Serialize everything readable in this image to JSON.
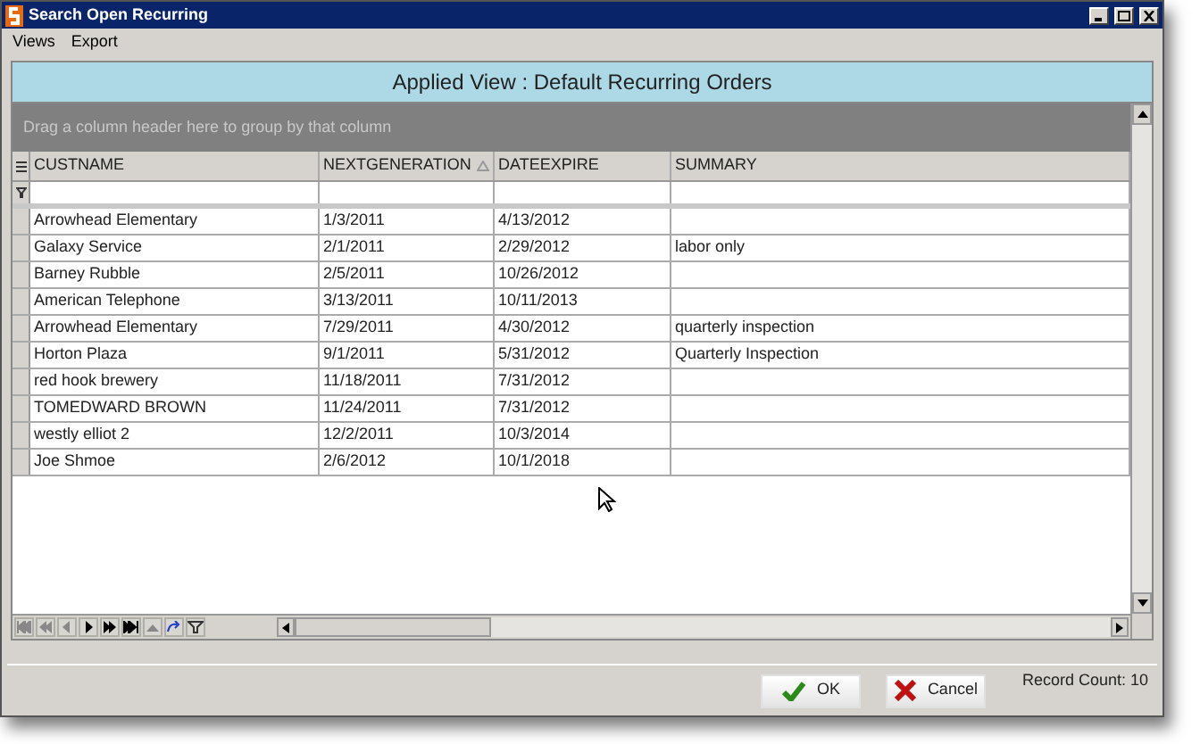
{
  "window": {
    "title": "Search Open Recurring"
  },
  "menu": [
    "Views",
    "Export"
  ],
  "view_header": "Applied View : Default Recurring Orders",
  "group_hint": "Drag a column header here to group by that column",
  "table": {
    "columns": [
      {
        "label": "CUSTNAME",
        "sorted": false
      },
      {
        "label": "NEXTGENERATION",
        "sorted": true
      },
      {
        "label": "DATEEXPIRE",
        "sorted": false
      },
      {
        "label": "SUMMARY",
        "sorted": false
      }
    ],
    "rows": [
      [
        "Arrowhead Elementary",
        "1/3/2011",
        "4/13/2012",
        ""
      ],
      [
        "Galaxy Service",
        "2/1/2011",
        "2/29/2012",
        "labor only"
      ],
      [
        "Barney Rubble",
        "2/5/2011",
        "10/26/2012",
        ""
      ],
      [
        "American Telephone",
        "3/13/2011",
        "10/11/2013",
        ""
      ],
      [
        "Arrowhead Elementary",
        "7/29/2011",
        "4/30/2012",
        "quarterly inspection"
      ],
      [
        "Horton Plaza",
        "9/1/2011",
        "5/31/2012",
        "Quarterly Inspection"
      ],
      [
        "red hook brewery",
        "11/18/2011",
        "7/31/2012",
        ""
      ],
      [
        "TOMEDWARD BROWN",
        "11/24/2011",
        "7/31/2012",
        ""
      ],
      [
        "westly elliot 2",
        "12/2/2011",
        "10/3/2014",
        ""
      ],
      [
        "Joe Shmoe",
        "2/6/2012",
        "10/1/2018",
        ""
      ]
    ]
  },
  "buttons": [
    {
      "label": "OK",
      "kind": "ok"
    },
    {
      "label": "Cancel",
      "kind": "cancel"
    }
  ],
  "record_count": "Record Count: 10"
}
